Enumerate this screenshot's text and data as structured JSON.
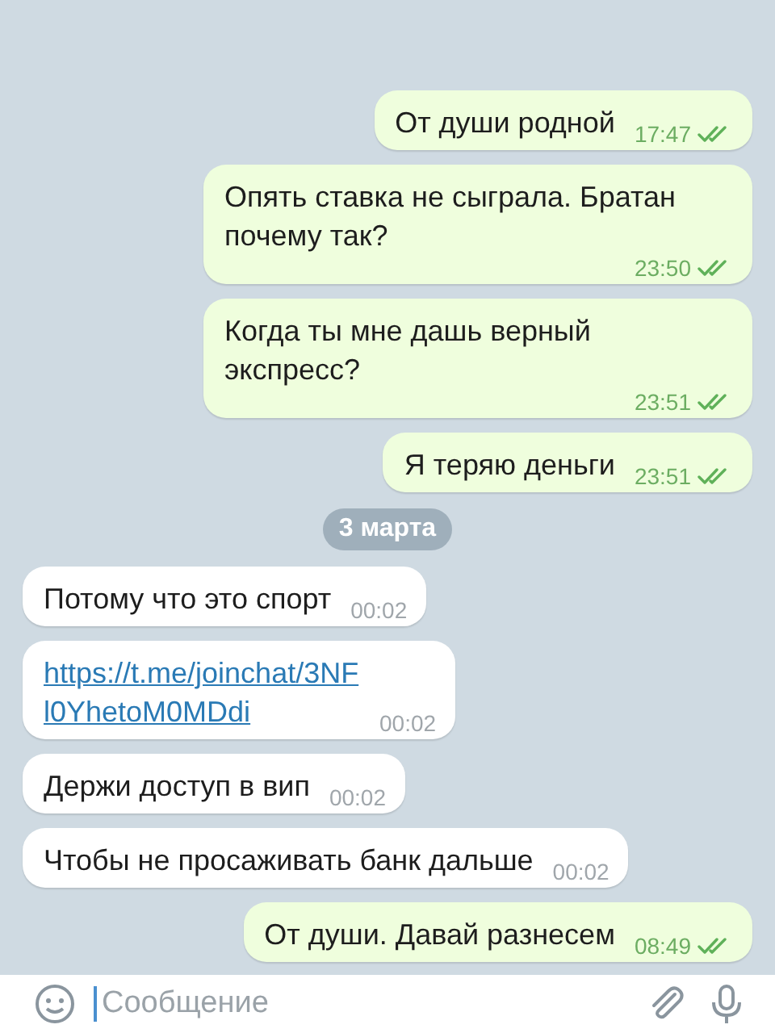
{
  "messages": [
    {
      "kind": "text",
      "outgoing": true,
      "text": "От души родной",
      "time": "17:47",
      "read": true
    },
    {
      "kind": "text",
      "outgoing": true,
      "text": "Опять ставка не сыграла. Братан почему так?",
      "time": "23:50",
      "read": true
    },
    {
      "kind": "text",
      "outgoing": true,
      "text": "Когда ты мне дашь верный экспресс?",
      "time": "23:51",
      "read": true
    },
    {
      "kind": "text",
      "outgoing": true,
      "text": "Я теряю деньги",
      "time": "23:51",
      "read": true
    },
    {
      "kind": "date",
      "text": "3 марта"
    },
    {
      "kind": "text",
      "outgoing": false,
      "text": "Потому что это спорт",
      "time": "00:02"
    },
    {
      "kind": "link",
      "outgoing": false,
      "text": "https://t.me/joinchat/3NFl0YhetoM0MDdi",
      "time": "00:02"
    },
    {
      "kind": "text",
      "outgoing": false,
      "text": "Держи доступ в вип",
      "time": "00:02"
    },
    {
      "kind": "text",
      "outgoing": false,
      "text": "Чтобы не просаживать банк дальше",
      "time": "00:02"
    },
    {
      "kind": "text",
      "outgoing": true,
      "text": "От души. Давай разнесем",
      "time": "08:49",
      "read": true
    }
  ],
  "composer": {
    "placeholder": "Сообщение"
  }
}
